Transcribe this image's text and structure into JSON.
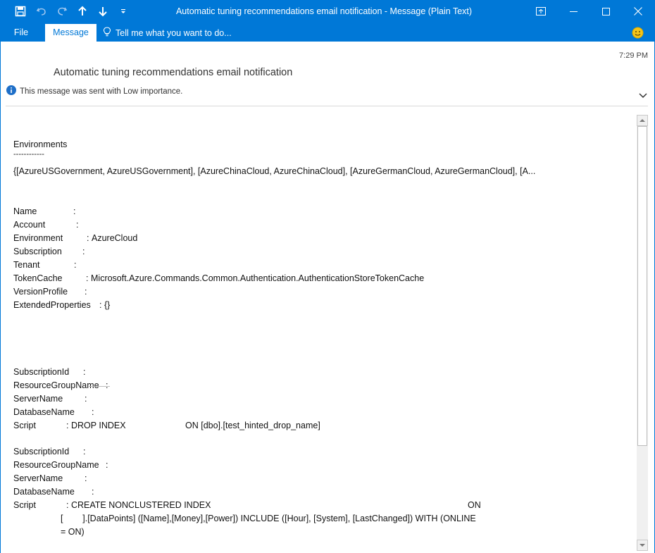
{
  "window": {
    "title": "Automatic tuning recommendations email notification - Message (Plain Text)"
  },
  "ribbon": {
    "tabs": [
      {
        "label": "File"
      },
      {
        "label": "Message"
      }
    ],
    "tell_me": "Tell me what you want to do..."
  },
  "header": {
    "time": "7:29 PM",
    "subject": "Automatic tuning recommendations email notification",
    "importance_note": "This message was sent with Low importance."
  },
  "body": {
    "env_heading": "Environments",
    "env_rule": "------------",
    "env_list": "{[AzureUSGovernment, AzureUSGovernment], [AzureChinaCloud, AzureChinaCloud], [AzureGermanCloud, AzureGermanCloud], [A...",
    "account_fields": [
      {
        "label": "Name",
        "value": ""
      },
      {
        "label": "Account",
        "value": ""
      },
      {
        "label": "Environment",
        "value": "AzureCloud"
      },
      {
        "label": "Subscription",
        "value": ""
      },
      {
        "label": "Tenant",
        "value": ""
      },
      {
        "label": "TokenCache",
        "value": "Microsoft.Azure.Commands.Common.Authentication.AuthenticationStoreTokenCache"
      },
      {
        "label": "VersionProfile",
        "value": ""
      },
      {
        "label": "ExtendedProperties",
        "value": "{}"
      }
    ],
    "rec1": {
      "subscription_label": "SubscriptionId",
      "rg_label": "ResourceGroupName",
      "server_label": "ServerName",
      "db_label": "DatabaseName",
      "script_label": "Script",
      "script_value": "DROP INDEX",
      "script_on": "ON [dbo].[test_hinted_drop_name]"
    },
    "rec2": {
      "subscription_label": "SubscriptionId",
      "rg_label": "ResourceGroupName",
      "server_label": "ServerName",
      "db_label": "DatabaseName",
      "script_label": "Script",
      "script_value": "CREATE NONCLUSTERED INDEX",
      "script_on": "ON",
      "script_line2": "[        ].[DataPoints] ([Name],[Money],[Power]) INCLUDE ([Hour], [System], [LastChanged]) WITH (ONLINE",
      "script_line3": "= ON)"
    }
  },
  "colors": {
    "titlebar": "#0078d7",
    "ribbon_active_tab_text": "#0078d7",
    "info_icon": "#1e6fc8",
    "smiley": "#f5c518"
  },
  "icons": [
    "save-icon",
    "undo-icon",
    "redo-icon",
    "up-arrow-icon",
    "down-arrow-icon",
    "customize-qat-icon",
    "ribbon-display-icon",
    "minimize-icon",
    "maximize-icon",
    "close-icon",
    "lightbulb-icon",
    "smiley-icon",
    "info-icon",
    "chevron-down-icon"
  ]
}
